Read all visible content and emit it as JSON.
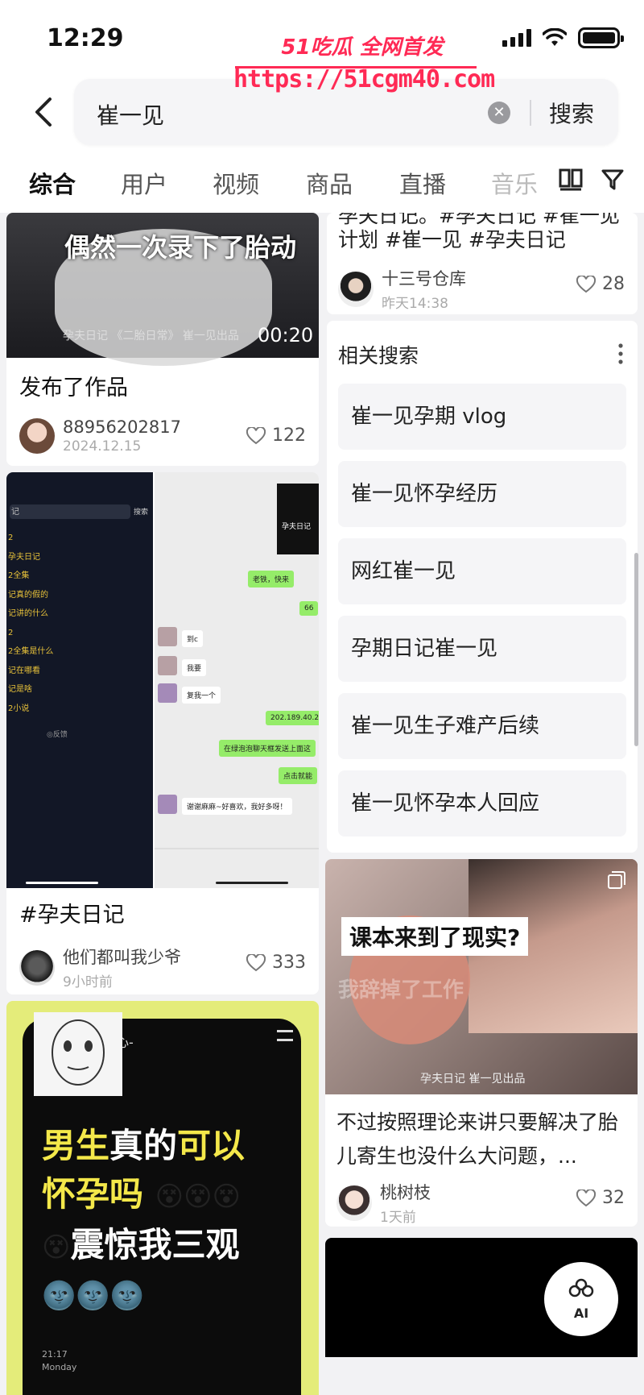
{
  "status_bar": {
    "time": "12:29"
  },
  "watermark": {
    "brand": "51吃瓜 全网首发",
    "url": "https://51cgm40.com"
  },
  "search": {
    "query": "崔一见",
    "button": "搜索"
  },
  "tabs": [
    "综合",
    "用户",
    "视频",
    "商品",
    "直播",
    "音乐"
  ],
  "feed_left": [
    {
      "caption": "偶然一次录下了胎动",
      "bottom_text": "孕夫日记 《二胎日常》 崔一见出品",
      "duration": "00:20",
      "title": "发布了作品",
      "author": "88956202817",
      "time": "2024.12.15",
      "likes": "122"
    },
    {
      "chat_left_items": [
        "记",
        "2",
        "孕夫日记",
        "2全集",
        "记真的假的",
        "记讲的什么",
        "2",
        "2全集是什么",
        "记在哪看",
        "记是啥",
        "2小说",
        "◎反馈"
      ],
      "chat_search_label": "搜索",
      "chat_right_title": "孕夫日记",
      "bubbles": [
        "老铁，快来",
        "66",
        "到c",
        "我要",
        "复我一个",
        "202.189.40.2",
        "在绿泡泡聊天框发送上面这",
        "点击就能",
        "谢谢麻麻~好喜欢，我好多呀！"
      ],
      "title": "#孕夫日记",
      "author": "他们都叫我少爷",
      "time": "9小时前",
      "likes": "333"
    },
    {
      "meme_top_text": "痴心-",
      "line1_a": "男生",
      "line1_b": "真的",
      "line1_c": "可以",
      "line2": "怀孕吗",
      "line3": "震惊我三观",
      "clock": "21:17",
      "day": "Monday"
    }
  ],
  "feed_right": [
    {
      "title_line1": "孕夫日记。#孕夫日记 #崔一见",
      "title_line2": "计划 #崔一见 #孕夫日记",
      "author": "十三号仓库",
      "time": "昨天14:38",
      "likes": "28"
    },
    {
      "overlay_text": "课本来到了现实?",
      "watermark_text": "我辞掉了工作",
      "bottom_text": "孕夫日记 崔一见出品",
      "title": "不过按照理论来讲只要解决了胎儿寄生也没什么大问题，...",
      "author": "桃树枝",
      "time": "1天前",
      "likes": "32"
    }
  ],
  "related": {
    "title": "相关搜索",
    "items": [
      "崔一见孕期 vlog",
      "崔一见怀孕经历",
      "网红崔一见",
      "孕期日记崔一见",
      "崔一见生子难产后续",
      "崔一见怀孕本人回应"
    ]
  },
  "ai_button": {
    "label": "AI"
  }
}
